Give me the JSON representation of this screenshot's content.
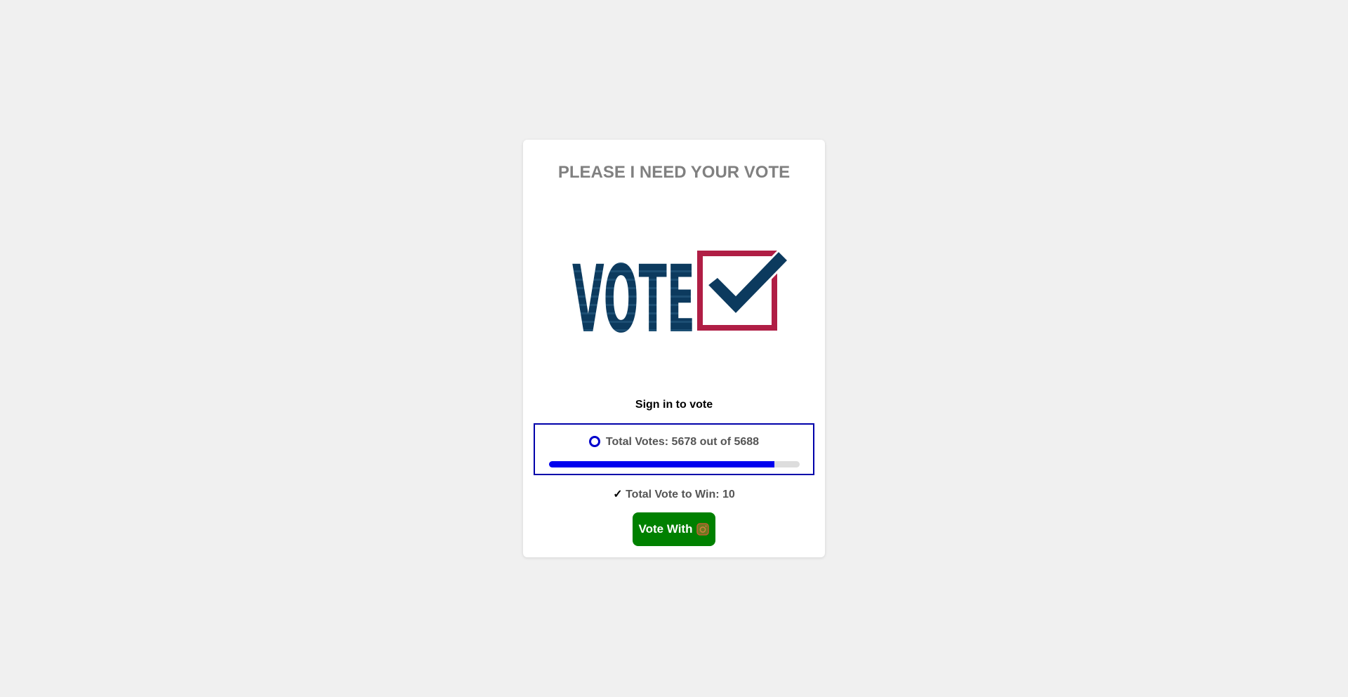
{
  "page": {
    "title": "PLEASE I NEED YOUR VOTE",
    "logo": {
      "text": "VOTE",
      "icon": "ballot-checkbox-icon",
      "colors": {
        "navy": "#0c3a5e",
        "red": "#b01e45"
      }
    },
    "signin_text": "Sign in to vote",
    "votes": {
      "label": "Total Votes: 5678 out of 5688",
      "current": 5678,
      "total": 5688,
      "progress_fraction": 0.9
    },
    "win": {
      "check": "✓",
      "label": "Total Vote to Win: 10"
    },
    "vote_button": {
      "label": "Vote With",
      "icon": "instagram-icon"
    },
    "colors": {
      "background": "#f0f0f0",
      "accent_blue": "#0000ee",
      "button_green": "#008000",
      "title_gray": "#808080"
    }
  }
}
